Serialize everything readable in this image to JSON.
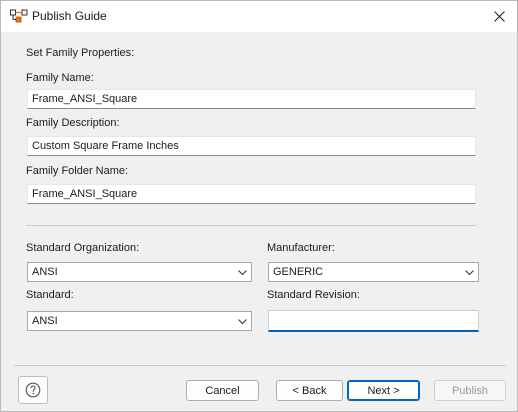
{
  "window": {
    "title": "Publish Guide"
  },
  "icons": {
    "app": "publish-guide-app-icon",
    "close": "close-icon",
    "help": "help-icon",
    "dropdown": "chevron-down-icon"
  },
  "form": {
    "section_heading": "Set Family Properties:",
    "family_name": {
      "label": "Family Name:",
      "value": "Frame_ANSI_Square"
    },
    "family_description": {
      "label": "Family Description:",
      "value": "Custom Square Frame Inches"
    },
    "family_folder_name": {
      "label": "Family Folder Name:",
      "value": "Frame_ANSI_Square"
    },
    "standard_organization": {
      "label": "Standard Organization:",
      "value": "ANSI"
    },
    "manufacturer": {
      "label": "Manufacturer:",
      "value": "GENERIC"
    },
    "standard": {
      "label": "Standard:",
      "value": "ANSI"
    },
    "standard_revision": {
      "label": "Standard Revision:",
      "value": ""
    }
  },
  "buttons": {
    "cancel": "Cancel",
    "back": "< Back",
    "next": "Next >",
    "publish": "Publish"
  },
  "colors": {
    "focus_accent": "#0063b1",
    "primary_border": "#0067c0"
  }
}
